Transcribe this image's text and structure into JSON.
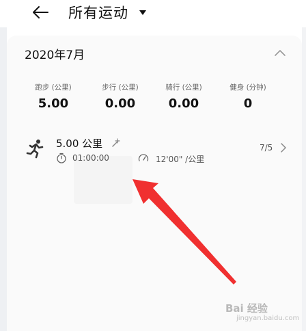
{
  "header": {
    "title": "所有运动"
  },
  "summary": {
    "month": "2020年7月",
    "stats": [
      {
        "label": "跑步 (公里)",
        "value": "5.00"
      },
      {
        "label": "步行 (公里)",
        "value": "0.00"
      },
      {
        "label": "骑行 (公里)",
        "value": "0.00"
      },
      {
        "label": "健身 (分钟)",
        "value": "0"
      }
    ]
  },
  "record": {
    "distance": "5.00 公里",
    "duration": "01:00:00",
    "pace": "12'00\" /公里",
    "date": "7/5"
  },
  "annotation": {
    "arrow_color": "#f03030"
  },
  "watermark": {
    "text": "Bai 经验",
    "sub": "jingyan.baidu.com"
  },
  "icons": [
    "back-arrow-icon",
    "dropdown-triangle-icon",
    "chevron-up-icon",
    "running-icon",
    "edit-icon",
    "timer-icon",
    "speedometer-icon",
    "chevron-right-icon"
  ]
}
